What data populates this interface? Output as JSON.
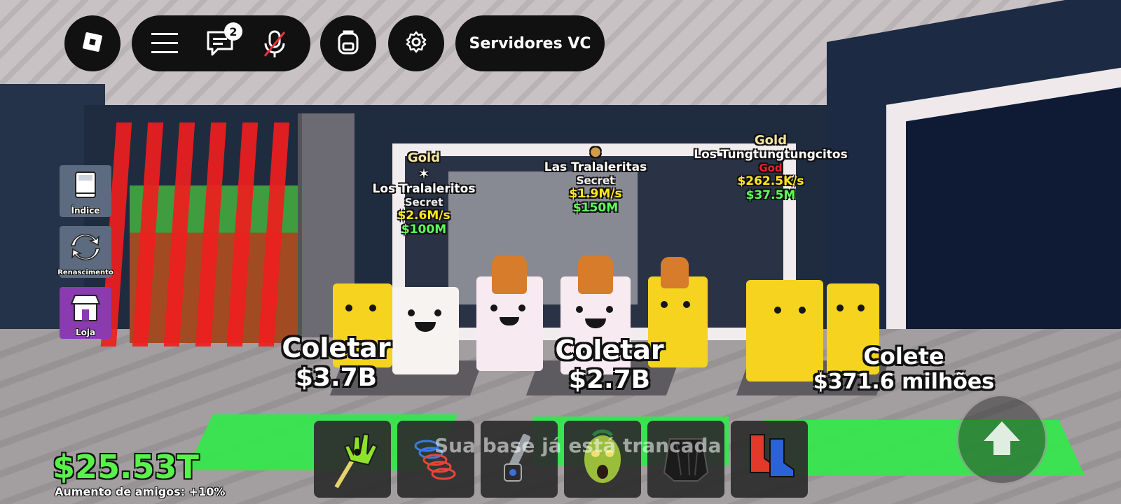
{
  "topbar": {
    "chat_badge": "2",
    "servers_label": "Servidores VC"
  },
  "side_menu": [
    {
      "label": "Índice",
      "icon": "book-icon",
      "color": "#5d6b80"
    },
    {
      "label": "Renascimento",
      "icon": "refresh-icon",
      "color": "#5d6b80"
    },
    {
      "label": "Loja",
      "icon": "shop-icon",
      "color": "#8b3bb0"
    }
  ],
  "billboards": [
    {
      "rarity": "Gold",
      "name": "Los Tralaleritos",
      "tier": "Secret",
      "rate": "$2.6M/s",
      "price": "$100M"
    },
    {
      "name": "Las Tralaleritas",
      "tier": "Secret",
      "rate": "$1.9M/s",
      "price": "$150M"
    },
    {
      "rarity": "Gold",
      "name": "Los Tungtungtungcitos",
      "tier": "God",
      "rate": "$262.5K/s",
      "price": "$37.5M"
    }
  ],
  "collect": [
    {
      "label": "Coletar",
      "amount": "$3.7B"
    },
    {
      "label": "Coletar",
      "amount": "$2.7B"
    },
    {
      "label": "Colete",
      "amount": "$371.6 milhões"
    }
  ],
  "hotbar": {
    "toast": "Sua base já está trancada",
    "items": [
      "green-slap-glove-icon",
      "coil-spring-icon",
      "flashlight-gadget-icon",
      "zombie-head-icon",
      "black-cape-icon",
      "blue-red-boots-icon"
    ]
  },
  "player": {
    "money": "$25.53T",
    "friend_bonus": "Aumento de amigos: +10%"
  },
  "colors": {
    "money": "#58f24a",
    "rate": "#ffe81a",
    "price": "#5cff5c",
    "rarity_gold": "#f3e4a0",
    "god": "#e7222a",
    "cage_bars": "#ee1e1e",
    "pad": "#37e64d"
  }
}
